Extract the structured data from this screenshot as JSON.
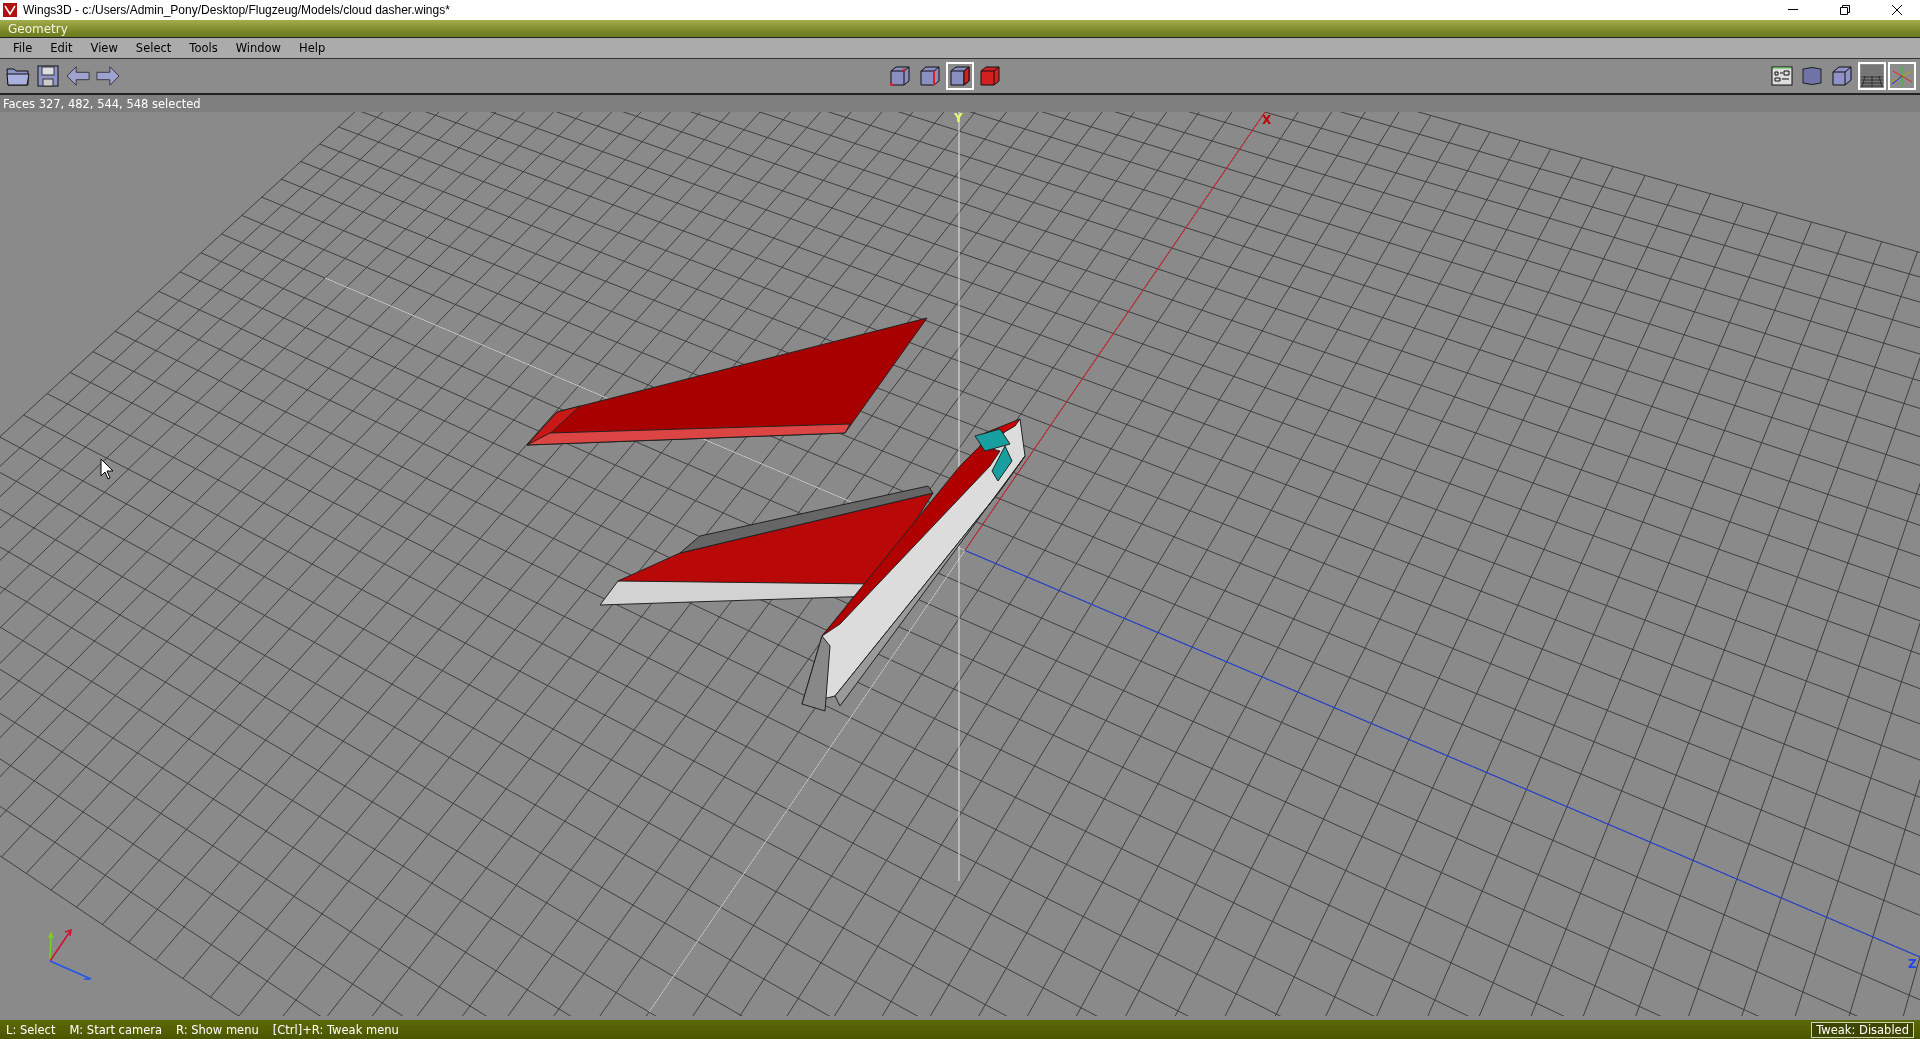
{
  "window": {
    "title": "Wings3D - c:/Users/Admin_Pony/Desktop/Flugzeug/Models/cloud dasher.wings*"
  },
  "panel": {
    "title": "Geometry"
  },
  "menu": [
    "File",
    "Edit",
    "View",
    "Select",
    "Tools",
    "Window",
    "Help"
  ],
  "toolbar": {
    "file_buttons": [
      {
        "kind": "open"
      },
      {
        "kind": "save"
      },
      {
        "kind": "undo"
      },
      {
        "kind": "redo"
      }
    ],
    "selection_modes": [
      {
        "kind": "vertex",
        "selected": false
      },
      {
        "kind": "edge",
        "selected": false
      },
      {
        "kind": "face",
        "selected": true
      },
      {
        "kind": "body",
        "selected": false
      }
    ],
    "view_toggles": [
      {
        "kind": "outliner",
        "selected": false
      },
      {
        "kind": "smooth",
        "selected": false
      },
      {
        "kind": "flat",
        "selected": false
      },
      {
        "kind": "ground",
        "selected": true
      },
      {
        "kind": "axes",
        "selected": true
      }
    ]
  },
  "info_line": "Faces 327, 482, 544, 548 selected",
  "viewport": {
    "axis_labels": [
      {
        "kind": "y",
        "label": "Y"
      },
      {
        "kind": "x",
        "label": "X"
      },
      {
        "kind": "z",
        "label": "Z"
      }
    ]
  },
  "status_bar": {
    "hints": [
      "L: Select",
      "M: Start camera",
      "R: Show menu",
      "[Ctrl]+R: Tweak menu"
    ],
    "tweak": "Tweak: Disabled"
  }
}
